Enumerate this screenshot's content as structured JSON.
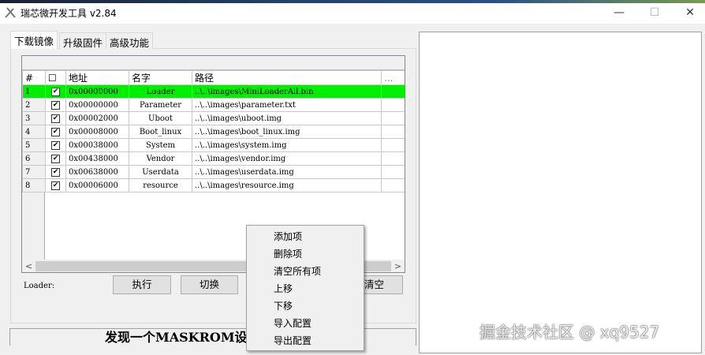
{
  "window": {
    "title": "瑞芯微开发工具 v2.84",
    "minimize": "—",
    "maximize": "☐",
    "close": "✕"
  },
  "tabs": [
    {
      "label": "下载镜像"
    },
    {
      "label": "升级固件"
    },
    {
      "label": "高级功能"
    }
  ],
  "table": {
    "headers": [
      "#",
      "☐",
      "地址",
      "名字",
      "路径",
      "..."
    ],
    "rows": [
      {
        "num": "1",
        "checked": "✔",
        "addr": "0x00000000",
        "name": "Loader",
        "path": "..\\..\\images\\MiniLoaderAll.bin"
      },
      {
        "num": "2",
        "checked": "✔",
        "addr": "0x00000000",
        "name": "Parameter",
        "path": "..\\..\\images\\parameter.txt"
      },
      {
        "num": "3",
        "checked": "✔",
        "addr": "0x00002000",
        "name": "Uboot",
        "path": "..\\..\\images\\uboot.img"
      },
      {
        "num": "4",
        "checked": "✔",
        "addr": "0x00008000",
        "name": "Boot_linux",
        "path": "..\\..\\images\\boot_linux.img"
      },
      {
        "num": "5",
        "checked": "✔",
        "addr": "0x00038000",
        "name": "System",
        "path": "..\\..\\images\\system.img"
      },
      {
        "num": "6",
        "checked": "✔",
        "addr": "0x00438000",
        "name": "Vendor",
        "path": "..\\..\\images\\vendor.img"
      },
      {
        "num": "7",
        "checked": "✔",
        "addr": "0x00638000",
        "name": "Userdata",
        "path": "..\\..\\images\\userdata.img"
      },
      {
        "num": "8",
        "checked": "✔",
        "addr": "0x00006000",
        "name": "resource",
        "path": "..\\..\\images\\resource.img"
      }
    ]
  },
  "loader_label": "Loader:",
  "buttons": {
    "run": "执行",
    "switch": "切换",
    "clear": "清空"
  },
  "status": "发现一个MASKROM设备",
  "context_menu": [
    "添加项",
    "删除项",
    "清空所有项",
    "上移",
    "下移",
    "导入配置",
    "导出配置"
  ],
  "watermark": "掘金技术社区 @ xq9527",
  "colors": {
    "selected_row": "#00ee00"
  }
}
